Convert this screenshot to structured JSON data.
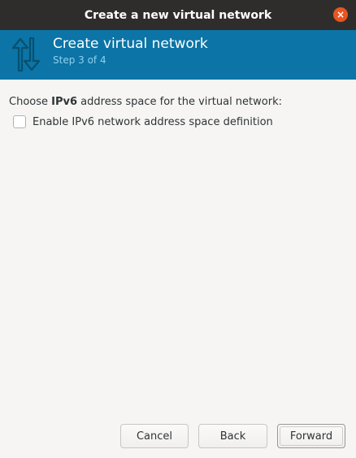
{
  "window": {
    "title": "Create a new virtual network",
    "close_glyph": "×"
  },
  "header": {
    "icon": "network-up-down-arrows-icon",
    "title": "Create virtual network",
    "step": "Step 3 of 4"
  },
  "content": {
    "prompt_prefix": "Choose ",
    "prompt_bold": "IPv6",
    "prompt_suffix": " address space for the virtual network:",
    "enable_ipv6_label": "Enable IPv6 network address space definition",
    "enable_ipv6_checked": false
  },
  "buttons": {
    "cancel": "Cancel",
    "back": "Back",
    "forward": "Forward"
  },
  "colors": {
    "header_band": "#0c74a6",
    "close_button": "#e95420",
    "titlebar": "#2e2d2c"
  }
}
